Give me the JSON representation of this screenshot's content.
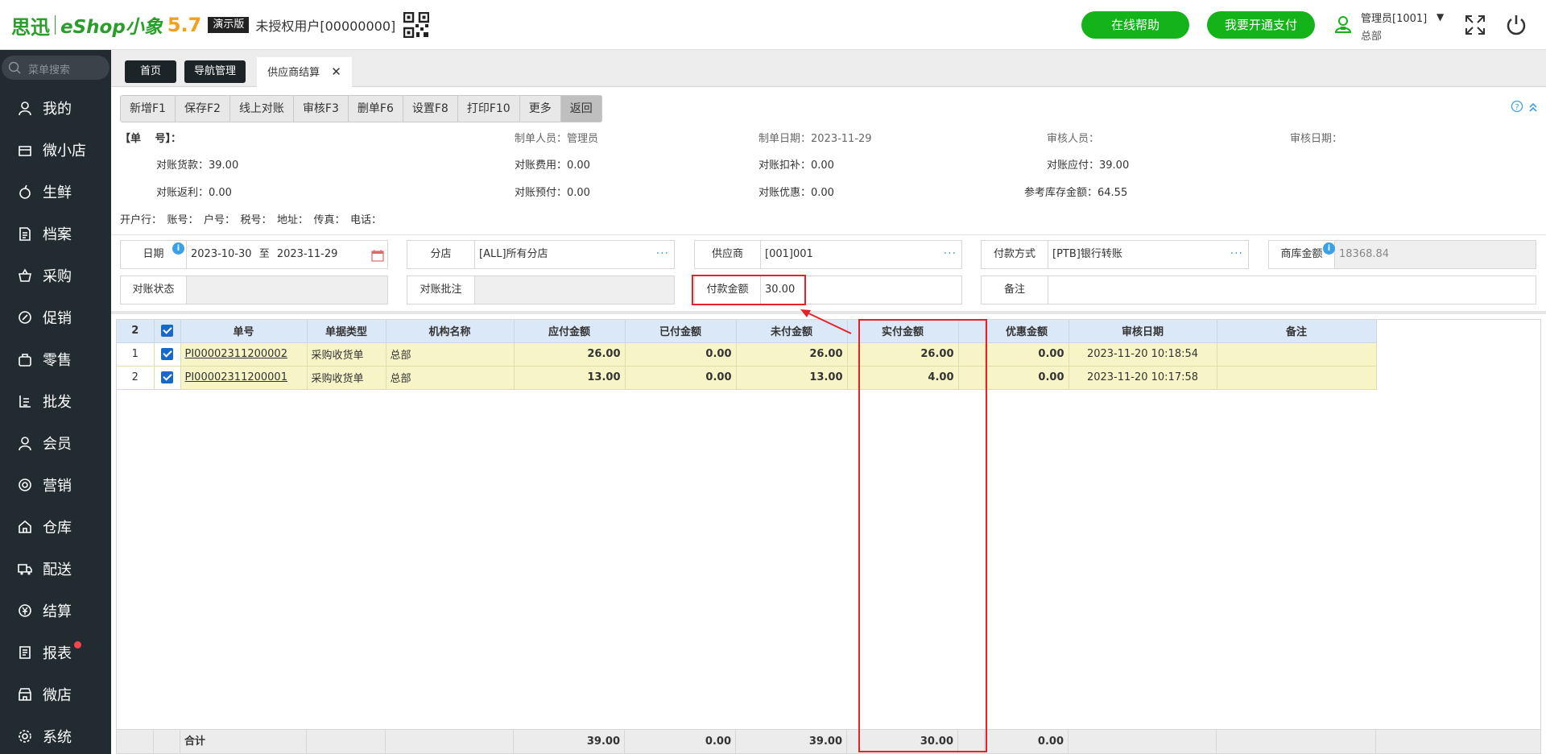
{
  "header": {
    "logo_cn": "思迅",
    "logo_en": "eShop小象",
    "logo_ver": "5.7",
    "demo_badge": "演示版",
    "unauth_user": "未授权用户[00000000]",
    "help_button": "在线帮助",
    "pay_button": "我要开通支付",
    "admin_name": "管理员[1001]",
    "admin_dept": "总部"
  },
  "sidebar": {
    "search_placeholder": "菜单搜索",
    "items": [
      {
        "label": "我的",
        "icon": "user-icon"
      },
      {
        "label": "微小店",
        "icon": "shop-icon"
      },
      {
        "label": "生鲜",
        "icon": "fruit-icon"
      },
      {
        "label": "档案",
        "icon": "document-icon"
      },
      {
        "label": "采购",
        "icon": "basket-icon"
      },
      {
        "label": "促销",
        "icon": "promo-icon"
      },
      {
        "label": "零售",
        "icon": "bag-icon"
      },
      {
        "label": "批发",
        "icon": "list-icon"
      },
      {
        "label": "会员",
        "icon": "member-icon"
      },
      {
        "label": "营销",
        "icon": "marketing-icon"
      },
      {
        "label": "仓库",
        "icon": "warehouse-icon"
      },
      {
        "label": "配送",
        "icon": "truck-icon"
      },
      {
        "label": "结算",
        "icon": "yen-icon"
      },
      {
        "label": "报表",
        "icon": "report-icon"
      },
      {
        "label": "微店",
        "icon": "store-icon"
      },
      {
        "label": "系统",
        "icon": "gear-icon"
      }
    ]
  },
  "tabs": [
    "首页",
    "导航管理",
    "供应商结算"
  ],
  "toolbar": [
    "新增F1",
    "保存F2",
    "线上对账",
    "审核F3",
    "删单F6",
    "设置F8",
    "打印F10",
    "更多",
    "返回"
  ],
  "info": {
    "doc_no": "【单　 号】：",
    "maker": "制单人员：管理员",
    "make_date": "制单日期：2023-11-29",
    "auditor": "审核人员：",
    "audit_date": "审核日期：",
    "goods_amt": "对账货款：39.00",
    "fee": "对账费用：0.00",
    "deduct": "对账扣补：0.00",
    "payable": "对账应付：39.00",
    "rebate": "对账返利：0.00",
    "prepay": "对账预付：0.00",
    "discount": "对账优惠：0.00",
    "stock_amt": "参考库存金额：64.55",
    "bank_line": "开户行：　账号：　户号：　税号：　地址：　传真：　电话："
  },
  "filters": {
    "date_label": "日期",
    "date_from": "2023-10-30",
    "date_to_word": "至",
    "date_to": "2023-11-29",
    "branch_label": "分店",
    "branch_value": "[ALL]所有分店",
    "supplier_label": "供应商",
    "supplier_value": "[001]001",
    "pay_method_label": "付款方式",
    "pay_method_value": "[PTB]银行转账",
    "stock_amt_label": "商库金额",
    "stock_amt_value": "18368.84",
    "status_label": "对账状态",
    "status_value": "",
    "note_batch_label": "对账批注",
    "note_batch_value": "",
    "pay_amt_label": "付款金额",
    "pay_amt_value": "30.00",
    "remark_label": "备注",
    "remark_value": ""
  },
  "grid": {
    "count": "2",
    "columns": [
      "单号",
      "单据类型",
      "机构名称",
      "应付金额",
      "已付金额",
      "未付金额",
      "实付金额",
      "",
      "优惠金额",
      "审核日期",
      "备注"
    ],
    "rows": [
      {
        "idx": "1",
        "no": "PI00002311200002",
        "type": "采购收货单",
        "org": "总部",
        "due": "26.00",
        "paid": "0.00",
        "unpaid": "26.00",
        "actual": "26.00",
        "disc": "0.00",
        "date": "2023-11-20 10:18:54",
        "remark": ""
      },
      {
        "idx": "2",
        "no": "PI00002311200001",
        "type": "采购收货单",
        "org": "总部",
        "due": "13.00",
        "paid": "0.00",
        "unpaid": "13.00",
        "actual": "4.00",
        "disc": "0.00",
        "date": "2023-11-20 10:17:58",
        "remark": ""
      }
    ],
    "footer": {
      "label": "合计",
      "due": "39.00",
      "paid": "0.00",
      "unpaid": "39.00",
      "actual": "30.00",
      "disc": "0.00"
    }
  },
  "colors": {
    "brand_green": "#14b31a",
    "sidebar_bg": "#222b2f",
    "highlight_red": "#e8202a"
  }
}
